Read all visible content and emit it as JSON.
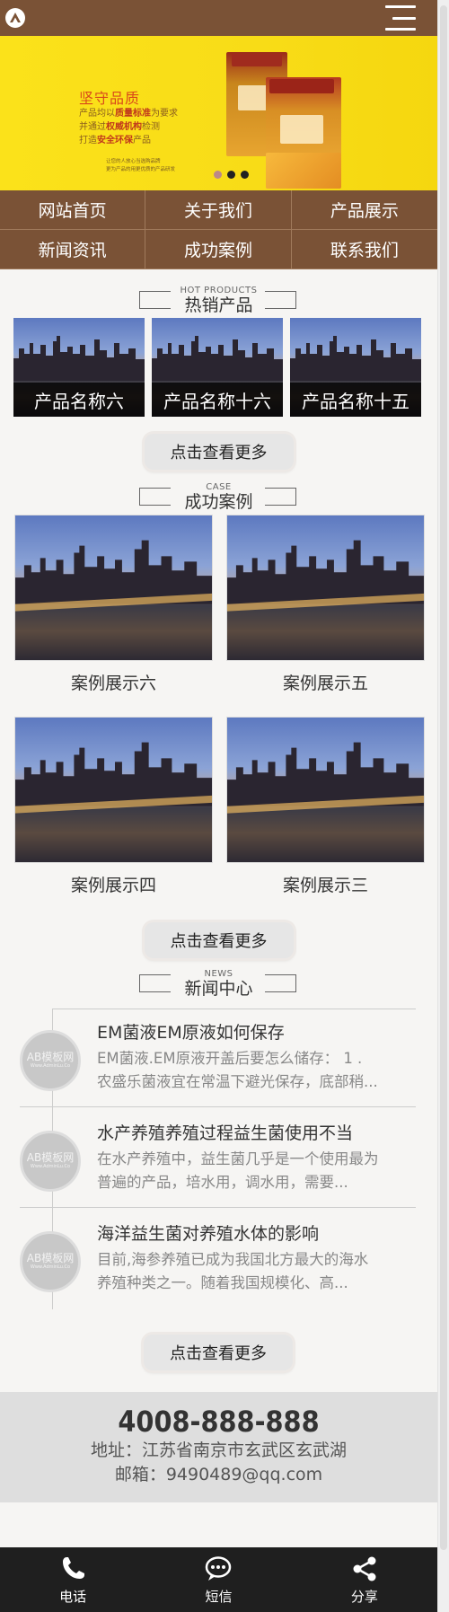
{
  "header": {
    "logo_icon": "logo-icon",
    "menu_icon": "menu-icon"
  },
  "banner": {
    "title": "坚守品质",
    "line1_a": "产品均以",
    "line1_b": "质量标准",
    "line1_c": "为要求",
    "line2_a": "并通过",
    "line2_b": "权威机构",
    "line2_c": "检测",
    "line3_a": "打造",
    "line3_b": "安全环保",
    "line3_c": "产品",
    "small1": "让您的人放心当选购品牌",
    "small2": "更为产品的用更优质的产品研发",
    "slides": 3,
    "active_slide": 1
  },
  "nav": [
    "网站首页",
    "关于我们",
    "产品展示",
    "新闻资讯",
    "成功案例",
    "联系我们"
  ],
  "products_section": {
    "en": "HOT PRODUCTS",
    "cn": "热销产品"
  },
  "products": [
    "产品名称六",
    "产品名称十六",
    "产品名称十五"
  ],
  "more_label": "点击查看更多",
  "cases_section": {
    "en": "CASE",
    "cn": "成功案例"
  },
  "cases": [
    "案例展示六",
    "案例展示五",
    "案例展示四",
    "案例展示三"
  ],
  "news_section": {
    "en": "NEWS",
    "cn": "新闻中心"
  },
  "avatar_text": {
    "main": "AB模板网",
    "sub": "Www.AdminLu.Co"
  },
  "news": [
    {
      "title": "EM菌液EM原液如何保存",
      "desc1": "EM菌液.EM原液开盖后要怎么储存： 1 .",
      "desc2": "农盛乐菌液宜在常温下避光保存，底部稍..."
    },
    {
      "title": "水产养殖养殖过程益生菌使用不当",
      "desc1": "在水产养殖中，益生菌几乎是一个使用最为",
      "desc2": "普遍的产品，培水用，调水用，需要..."
    },
    {
      "title": "海洋益生菌对养殖水体的影响",
      "desc1": "目前,海参养殖已成为我国北方最大的海水",
      "desc2": "养殖种类之一。随着我国规模化、高..."
    }
  ],
  "contact": {
    "phone": "4008-888-888",
    "address": "地址：江苏省南京市玄武区玄武湖",
    "email": "邮箱：9490489@qq.com"
  },
  "footer": [
    {
      "label": "电话",
      "icon": "phone-icon"
    },
    {
      "label": "短信",
      "icon": "message-icon"
    },
    {
      "label": "分享",
      "icon": "share-icon"
    }
  ],
  "colors": {
    "brand": "#7a5236",
    "banner": "#fbe21a",
    "footer": "#1f1f1f"
  }
}
